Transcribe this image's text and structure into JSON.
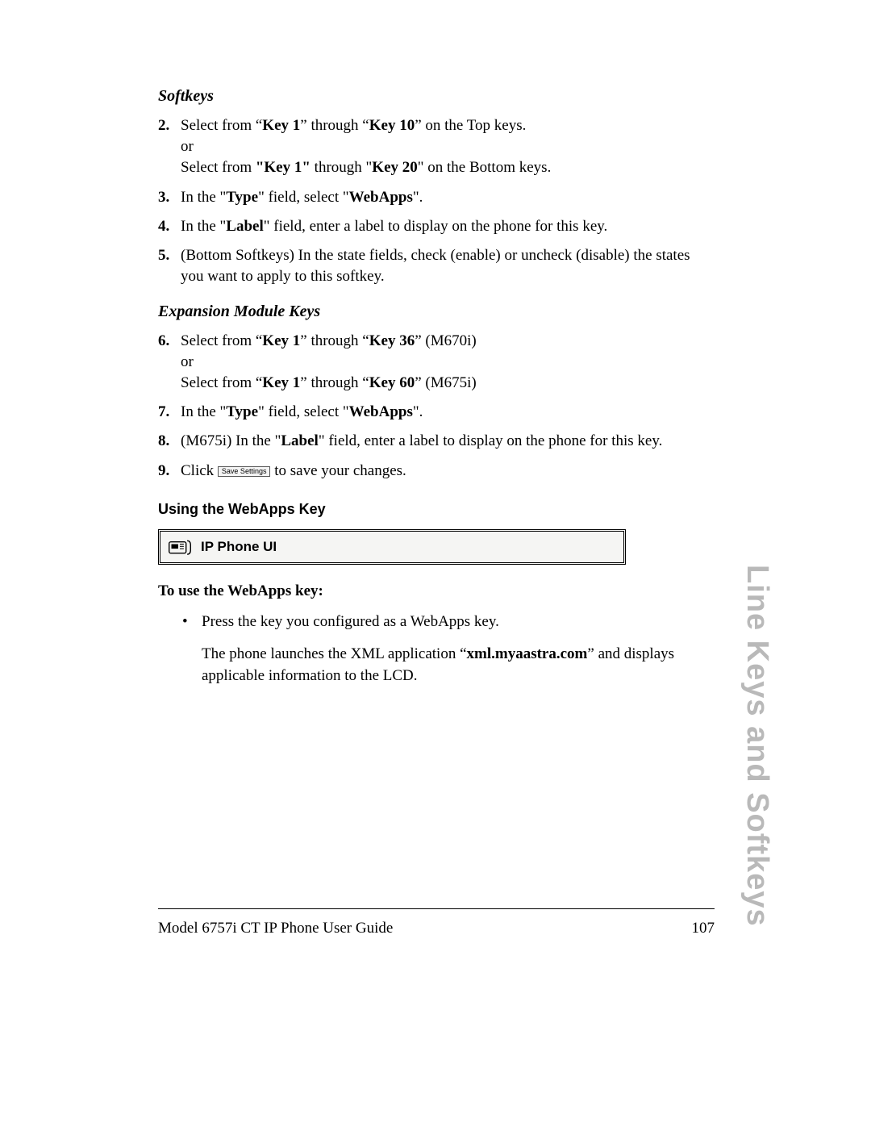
{
  "headings": {
    "softkeys": "Softkeys",
    "expansion": "Expansion Module Keys",
    "using": "Using the WebApps Key",
    "ip_phone_ui": "IP Phone UI",
    "to_use": "To use the WebApps key:"
  },
  "steps": {
    "s2_a1": "Select from “",
    "s2_b1": "Key 1",
    "s2_a2": "” through “",
    "s2_b2": "Key 10",
    "s2_a3": "” on the Top keys.",
    "s2_or": "or",
    "s2_c1": "Select from ",
    "s2_d1": "\"Key 1\"",
    "s2_c2": " through \"",
    "s2_d2": "Key 20",
    "s2_c3": "\" on the Bottom keys.",
    "s3_a": "In the \"",
    "s3_b": "Type",
    "s3_c": "\" field, select \"",
    "s3_d": "WebApps",
    "s3_e": "\".",
    "s4_a": "In the \"",
    "s4_b": "Label",
    "s4_c": "\" field, enter a label to display on the phone for this key.",
    "s5": "(Bottom Softkeys) In the state fields, check (enable) or uncheck (disable) the states you want to apply to this softkey.",
    "s6_a1": "Select from “",
    "s6_b1": "Key 1",
    "s6_a2": "” through “",
    "s6_b2": "Key 36",
    "s6_a3": "” (M670i)",
    "s6_or": "or",
    "s6_c1": "Select from “",
    "s6_d1": "Key 1",
    "s6_c2": "” through “",
    "s6_d2": "Key 60",
    "s6_c3": "” (M675i)",
    "s7_a": "In the \"",
    "s7_b": "Type",
    "s7_c": "\" field, select \"",
    "s7_d": "WebApps",
    "s7_e": "\".",
    "s8_a": "(M675i) In the \"",
    "s8_b": "Label",
    "s8_c": "\" field, enter a label to display on the phone for this key.",
    "s9_a": "Click ",
    "s9_btn": "Save Settings",
    "s9_b": " to save your changes."
  },
  "bullet": {
    "b1": "Press the key you configured as a WebApps key.",
    "b2_a": "The phone launches the XML application “",
    "b2_b": "xml.myaastra.com",
    "b2_c": "” and displays applicable information to the LCD."
  },
  "side": "Line Keys and Softkeys",
  "footer": {
    "left": "Model 6757i CT IP Phone User Guide",
    "right": "107"
  },
  "nums": {
    "n2": "2.",
    "n3": "3.",
    "n4": "4.",
    "n5": "5.",
    "n6": "6.",
    "n7": "7.",
    "n8": "8.",
    "n9": "9."
  }
}
